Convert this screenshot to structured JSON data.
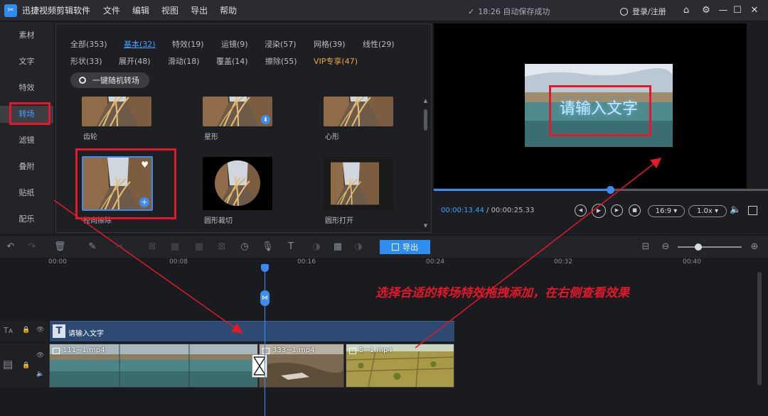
{
  "app": {
    "title": "迅捷视频剪辑软件",
    "logo_glyph": "✂",
    "menu": [
      "文件",
      "编辑",
      "视图",
      "导出",
      "帮助"
    ],
    "save_status": "18:26 自动保存成功",
    "login": "登录/注册",
    "icons": [
      "home-icon",
      "settings-icon",
      "minimize-icon",
      "maximize-icon",
      "close-icon"
    ],
    "icon_glyphs": {
      "check": "✓",
      "home": "⌂",
      "settings": "⚙",
      "minimize": "—",
      "maximize": "☐",
      "close": "✕"
    }
  },
  "sidebar": {
    "items": [
      {
        "label": "素材",
        "active": false
      },
      {
        "label": "文字",
        "active": false
      },
      {
        "label": "特效",
        "active": false
      },
      {
        "label": "转场",
        "active": true
      },
      {
        "label": "滤镜",
        "active": false
      },
      {
        "label": "叠附",
        "active": false
      },
      {
        "label": "贴纸",
        "active": false
      },
      {
        "label": "配乐",
        "active": false
      }
    ]
  },
  "transitions": {
    "categories": [
      {
        "label": "全部(353)",
        "active": false,
        "vip": false
      },
      {
        "label": "基本(32)",
        "active": true,
        "vip": false
      },
      {
        "label": "特效(19)",
        "active": false,
        "vip": false
      },
      {
        "label": "运镜(9)",
        "active": false,
        "vip": false
      },
      {
        "label": "浸染(57)",
        "active": false,
        "vip": false
      },
      {
        "label": "网格(39)",
        "active": false,
        "vip": false
      },
      {
        "label": "线性(29)",
        "active": false,
        "vip": false
      },
      {
        "label": "形状(33)",
        "active": false,
        "vip": false
      },
      {
        "label": "展开(48)",
        "active": false,
        "vip": false
      },
      {
        "label": "滑动(18)",
        "active": false,
        "vip": false
      },
      {
        "label": "覆盖(14)",
        "active": false,
        "vip": false
      },
      {
        "label": "擦除(55)",
        "active": false,
        "vip": false
      },
      {
        "label": "VIP专享(47)",
        "active": false,
        "vip": true
      }
    ],
    "random_button": "一键随机转场",
    "items": [
      {
        "label": "齿轮",
        "shape": "rect"
      },
      {
        "label": "星形",
        "shape": "rect",
        "download": true
      },
      {
        "label": "心形",
        "shape": "rect"
      },
      {
        "label": "径向擦除",
        "shape": "rect",
        "selected": true
      },
      {
        "label": "圆形裁切",
        "shape": "circle"
      },
      {
        "label": "圆形打开",
        "shape": "rect"
      }
    ],
    "icon_glyphs": {
      "heart": "♥",
      "plus": "+",
      "download": "⬇",
      "scroll_up": "▲",
      "scroll_down": "▼"
    }
  },
  "preview": {
    "overlay_text": "请输入文字",
    "current_time": "00:00:13.44",
    "separator": " / ",
    "total_time": "00:00:25.33",
    "progress": 0.527,
    "aspect": "16:9 ▾",
    "speed": "1.0x ▾",
    "icon_glyphs": {
      "prev": "◀",
      "play": "▶",
      "next": "▶",
      "stop": "■",
      "volume": "🔈"
    }
  },
  "toolbar": {
    "export_label": "导出",
    "zoom_level": 0.32,
    "icon_glyphs": {
      "undo": "↶",
      "redo": "↷",
      "delete": "🗑",
      "edit": "✎",
      "cut": "✂",
      "crop": "⊠",
      "speed": "◷",
      "mic": "🎙",
      "text": "T",
      "color": "◑",
      "mosaic": "▦",
      "zoom_out": "⊖",
      "zoom_in": "⊕",
      "fit": "⊟"
    }
  },
  "timeline": {
    "ruler": [
      "00:00",
      "00:08",
      "00:16",
      "00:24",
      "00:32",
      "00:40"
    ],
    "text_clip": "请输入文字",
    "text_clip_glyph": "T",
    "video_clips": [
      "111~1.mp4",
      "333~1.mp4",
      "5~1.mp4"
    ],
    "track_glyphs": {
      "text_track": "Tᴀ",
      "video_track": "▤",
      "lock": "🔒",
      "eye": "👁",
      "volume": "🔈",
      "transition": "⋈"
    }
  },
  "annotation": "选择合适的转场特效拖拽添加，在右侧查看效果",
  "colors": {
    "accent": "#2f8df0",
    "highlight": "#e3182a",
    "vip": "#e8a637",
    "text_clip": "#2d4a72"
  }
}
